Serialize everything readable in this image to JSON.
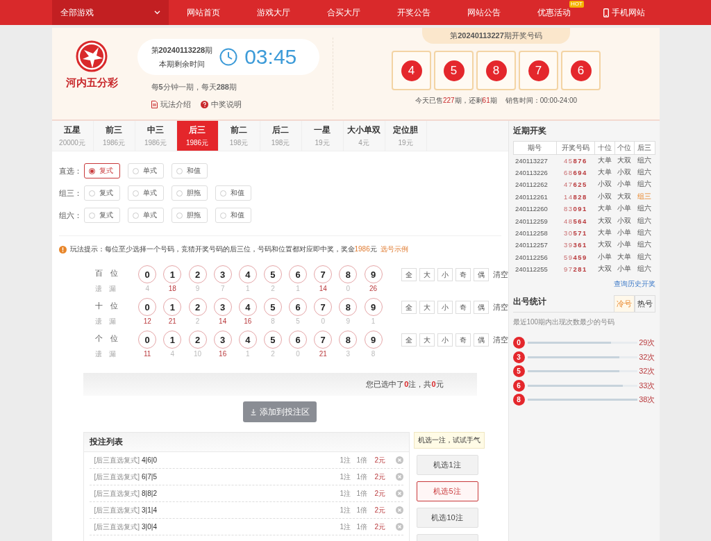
{
  "nav": {
    "all_games": "全部游戏",
    "items": [
      {
        "label": "网站首页"
      },
      {
        "label": "游戏大厅"
      },
      {
        "label": "合买大厅"
      },
      {
        "label": "开奖公告"
      },
      {
        "label": "网站公告"
      },
      {
        "label": "优惠活动",
        "badge": "HOT"
      }
    ],
    "mobile": "手机网站"
  },
  "header": {
    "logo_name": "河内五分彩",
    "issue": "第**20240113228**期",
    "countdown_label": "本期剩余时间",
    "countdown": "03:45",
    "schedule": "每**5**分钟一期，每天**288**期",
    "links": [
      {
        "kind": "doc",
        "label": "玩法介绍"
      },
      {
        "kind": "help",
        "label": "中奖说明"
      }
    ]
  },
  "last_draw": {
    "title": "第**20240113227**期开奖号码",
    "balls": [
      "4",
      "5",
      "8",
      "7",
      "6"
    ],
    "status": [
      {
        "text": "今天已售",
        "em": false
      },
      {
        "text": "227",
        "em": true
      },
      {
        "text": "期，还剩",
        "em": false
      },
      {
        "text": "61",
        "em": true
      },
      {
        "text": "期",
        "em": false
      }
    ],
    "sale_hours": "销售时间：00:00-24:00"
  },
  "tabs": [
    {
      "name": "五星",
      "prize": "20000元",
      "selected": false
    },
    {
      "name": "前三",
      "prize": "1986元",
      "selected": false
    },
    {
      "name": "中三",
      "prize": "1986元",
      "selected": false
    },
    {
      "name": "后三",
      "prize": "1986元",
      "selected": true
    },
    {
      "name": "前二",
      "prize": "198元",
      "selected": false
    },
    {
      "name": "后二",
      "prize": "198元",
      "selected": false
    },
    {
      "name": "一星",
      "prize": "19元",
      "selected": false
    },
    {
      "name": "大小单双",
      "prize": "4元",
      "selected": false
    },
    {
      "name": "定位胆",
      "prize": "19元",
      "selected": false
    }
  ],
  "play_options": [
    {
      "label": "直选：",
      "options": [
        {
          "label": "复式",
          "selected": true
        },
        {
          "label": "单式",
          "selected": false
        },
        {
          "label": "和值",
          "selected": false
        }
      ]
    },
    {
      "label": "组三：",
      "options": [
        {
          "label": "复式",
          "selected": false
        },
        {
          "label": "单式",
          "selected": false
        },
        {
          "label": "胆拖",
          "selected": false
        },
        {
          "label": "和值",
          "selected": false
        }
      ]
    },
    {
      "label": "组六：",
      "options": [
        {
          "label": "复式",
          "selected": false
        },
        {
          "label": "单式",
          "selected": false
        },
        {
          "label": "胆拖",
          "selected": false
        },
        {
          "label": "和值",
          "selected": false
        }
      ]
    }
  ],
  "hint": {
    "segments": [
      {
        "text": "玩法提示：每位至少选择一个号码，竞猜开奖号码的后三位，号码和位置都对应即中奖，奖金",
        "em": false
      },
      {
        "text": "1986",
        "em": true
      },
      {
        "text": "元",
        "em": false
      }
    ],
    "link": "选号示例"
  },
  "picker": [
    {
      "position": "百位",
      "miss_label": "遗漏",
      "balls": [
        "0",
        "1",
        "2",
        "3",
        "4",
        "5",
        "6",
        "7",
        "8",
        "9"
      ],
      "misses": [
        {
          "value": "4",
          "hot": false
        },
        {
          "value": "18",
          "hot": true
        },
        {
          "value": "9",
          "hot": false
        },
        {
          "value": "7",
          "hot": false
        },
        {
          "value": "1",
          "hot": false
        },
        {
          "value": "2",
          "hot": false
        },
        {
          "value": "1",
          "hot": false
        },
        {
          "value": "14",
          "hot": true
        },
        {
          "value": "0",
          "hot": false
        },
        {
          "value": "26",
          "hot": true
        }
      ],
      "quick": [
        "全",
        "大",
        "小",
        "奇",
        "偶"
      ],
      "clear": "清空"
    },
    {
      "position": "十位",
      "miss_label": "遗漏",
      "balls": [
        "0",
        "1",
        "2",
        "3",
        "4",
        "5",
        "6",
        "7",
        "8",
        "9"
      ],
      "misses": [
        {
          "value": "12",
          "hot": true
        },
        {
          "value": "21",
          "hot": true
        },
        {
          "value": "2",
          "hot": false
        },
        {
          "value": "14",
          "hot": true
        },
        {
          "value": "16",
          "hot": true
        },
        {
          "value": "8",
          "hot": false
        },
        {
          "value": "5",
          "hot": false
        },
        {
          "value": "0",
          "hot": false
        },
        {
          "value": "9",
          "hot": false
        },
        {
          "value": "1",
          "hot": false
        }
      ],
      "quick": [
        "全",
        "大",
        "小",
        "奇",
        "偶"
      ],
      "clear": "清空"
    },
    {
      "position": "个位",
      "miss_label": "遗漏",
      "balls": [
        "0",
        "1",
        "2",
        "3",
        "4",
        "5",
        "6",
        "7",
        "8",
        "9"
      ],
      "misses": [
        {
          "value": "11",
          "hot": true
        },
        {
          "value": "4",
          "hot": false
        },
        {
          "value": "10",
          "hot": false
        },
        {
          "value": "16",
          "hot": true
        },
        {
          "value": "1",
          "hot": false
        },
        {
          "value": "2",
          "hot": false
        },
        {
          "value": "0",
          "hot": false
        },
        {
          "value": "21",
          "hot": true
        },
        {
          "value": "3",
          "hot": false
        },
        {
          "value": "8",
          "hot": false
        }
      ],
      "quick": [
        "全",
        "大",
        "小",
        "奇",
        "偶"
      ],
      "clear": "清空"
    }
  ],
  "summary": [
    {
      "text": "您已选中了",
      "em": false
    },
    {
      "text": "0",
      "em": true
    },
    {
      "text": "注，共",
      "em": false
    },
    {
      "text": "0",
      "em": true
    },
    {
      "text": "元",
      "em": false
    }
  ],
  "add_button": "添加到投注区",
  "bets": {
    "title": "投注列表",
    "rows": [
      {
        "play": "[后三直选复式]",
        "numbers": "4|6|0",
        "count": "1注",
        "multiple": "1倍",
        "amount": "2元"
      },
      {
        "play": "[后三直选复式]",
        "numbers": "6|7|5",
        "count": "1注",
        "multiple": "1倍",
        "amount": "2元"
      },
      {
        "play": "[后三直选复式]",
        "numbers": "8|8|2",
        "count": "1注",
        "multiple": "1倍",
        "amount": "2元"
      },
      {
        "play": "[后三直选复式]",
        "numbers": "3|1|4",
        "count": "1注",
        "multiple": "1倍",
        "amount": "2元"
      },
      {
        "play": "[后三直选复式]",
        "numbers": "3|0|4",
        "count": "1注",
        "multiple": "1倍",
        "amount": "2元"
      }
    ]
  },
  "random_pick": {
    "tip": "机选一注，试试手气",
    "buttons": [
      {
        "label": "机选1注",
        "selected": false
      },
      {
        "label": "机选5注",
        "selected": true
      },
      {
        "label": "机选10注",
        "selected": false
      },
      {
        "selected": false
      }
    ]
  },
  "recent": {
    "title": "近期开奖",
    "columns": [
      "期号",
      "开奖号码",
      "十位",
      "个位",
      "后三"
    ],
    "rows": [
      {
        "issue": "240113227",
        "numbers": "45876",
        "ten": "大单",
        "unit": "大双",
        "back3": "组六",
        "highlight": false
      },
      {
        "issue": "240113226",
        "numbers": "68694",
        "ten": "大单",
        "unit": "小双",
        "back3": "组六",
        "highlight": false
      },
      {
        "issue": "240112262",
        "numbers": "47625",
        "ten": "小双",
        "unit": "小单",
        "back3": "组六",
        "highlight": false
      },
      {
        "issue": "240112261",
        "numbers": "14828",
        "ten": "小双",
        "unit": "大双",
        "back3": "组三",
        "highlight": true
      },
      {
        "issue": "240112260",
        "numbers": "83091",
        "ten": "大单",
        "unit": "小单",
        "back3": "组六",
        "highlight": false
      },
      {
        "issue": "240112259",
        "numbers": "48564",
        "ten": "大双",
        "unit": "小双",
        "back3": "组六",
        "highlight": false
      },
      {
        "issue": "240112258",
        "numbers": "30571",
        "ten": "大单",
        "unit": "小单",
        "back3": "组六",
        "highlight": false
      },
      {
        "issue": "240112257",
        "numbers": "39361",
        "ten": "大双",
        "unit": "小单",
        "back3": "组六",
        "highlight": false
      },
      {
        "issue": "240112256",
        "numbers": "59459",
        "ten": "小单",
        "unit": "大单",
        "back3": "组六",
        "highlight": false
      },
      {
        "issue": "240112255",
        "numbers": "97281",
        "ten": "大双",
        "unit": "小单",
        "back3": "组六",
        "highlight": false
      }
    ],
    "history_link": "查询历史开奖"
  },
  "stats": {
    "title": "出号统计",
    "tabs": [
      {
        "label": "冷号",
        "selected": true
      },
      {
        "label": "热号",
        "selected": false
      }
    ],
    "caption": "最近100期内出现次数最少的号码",
    "items": [
      {
        "number": "0",
        "level": 0.76,
        "count": "29次"
      },
      {
        "number": "3",
        "level": 0.84,
        "count": "32次"
      },
      {
        "number": "5",
        "level": 0.84,
        "count": "32次"
      },
      {
        "number": "6",
        "level": 0.87,
        "count": "33次"
      },
      {
        "number": "8",
        "level": 1.0,
        "count": "38次"
      }
    ]
  }
}
